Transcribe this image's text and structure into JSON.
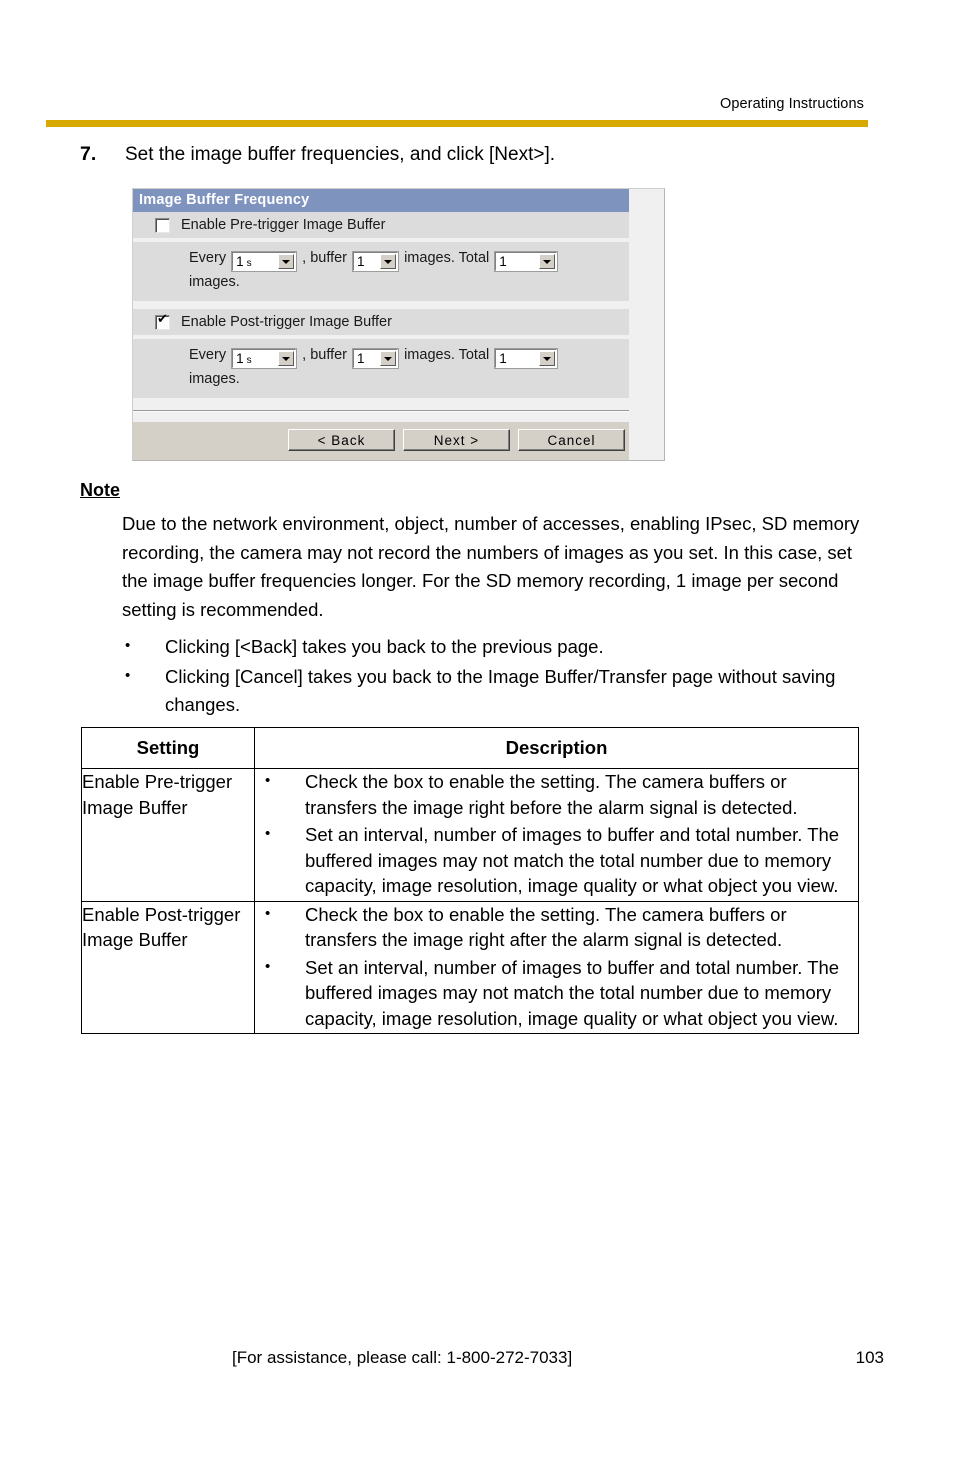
{
  "header": {
    "title": "Operating Instructions",
    "rule_color": "#d8a900"
  },
  "step": {
    "number": "7.",
    "text": "Set the image buffer frequencies, and click [Next>]."
  },
  "dialog": {
    "title": "Image Buffer Frequency",
    "titlebar_color": "#7f93bf",
    "sections": [
      {
        "checkbox_label": "Enable Pre-trigger Image Buffer",
        "checked": false,
        "prefix_label": "Every",
        "interval_value": "1",
        "interval_unit": "s",
        "middle_label": ", buffer",
        "buffer_value": "1",
        "after_buffer_label": "images. Total",
        "total_value": "1",
        "suffix_label": "images."
      },
      {
        "checkbox_label": "Enable Post-trigger Image Buffer",
        "checked": true,
        "prefix_label": "Every",
        "interval_value": "1",
        "interval_unit": "s",
        "middle_label": ", buffer",
        "buffer_value": "1",
        "after_buffer_label": "images. Total",
        "total_value": "1",
        "suffix_label": "images."
      }
    ],
    "buttons": {
      "back": "< Back",
      "next": "Next >",
      "cancel": "Cancel"
    }
  },
  "note": {
    "heading": "Note",
    "paragraph": "Due to the network environment, object, number of accesses, enabling IPsec, SD memory recording, the camera may not record the numbers of images as you set. In this case, set the image buffer frequencies longer. For the SD memory recording, 1 image per second setting is recommended.",
    "bullet_glyph": "•",
    "bullets": [
      "Clicking [<Back] takes you back to the previous page.",
      "Clicking [Cancel] takes you back to the Image Buffer/Transfer page without saving changes."
    ]
  },
  "table": {
    "headers": [
      "Setting",
      "Description"
    ],
    "bullet_glyph": "•",
    "rows": [
      {
        "setting": "Enable Pre-trigger Image Buffer",
        "description": [
          "Check the box to enable the setting. The camera buffers or transfers the image right before the alarm signal is detected.",
          "Set an interval, number of images to buffer and total number. The buffered images may not match the total number due to memory capacity, image resolution, image quality or what object you view."
        ]
      },
      {
        "setting": "Enable Post-trigger Image Buffer",
        "description": [
          "Check the box to enable the setting. The camera buffers or transfers the image right after the alarm signal is detected.",
          "Set an interval, number of images to buffer and total number. The buffered images may not match the total number due to memory capacity, image resolution, image quality or what object you view."
        ]
      }
    ]
  },
  "footer": {
    "assistance": "[For assistance, please call: 1-800-272-7033]",
    "page_number": "103"
  },
  "icons": {
    "checkbox_tick": "✔",
    "dropdown_arrow": "dropdown-arrow-icon"
  }
}
